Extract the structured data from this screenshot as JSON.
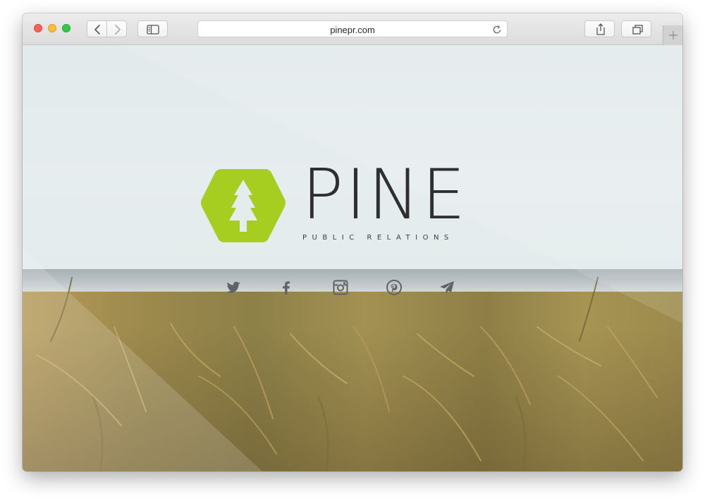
{
  "browser": {
    "url": "pinepr.com",
    "icons": [
      "back-chevron-icon",
      "forward-chevron-icon",
      "sidebar-icon",
      "reload-icon",
      "share-icon",
      "tabs-icon",
      "plus-icon"
    ]
  },
  "site": {
    "brand_name": "PINE",
    "tagline": "PUBLIC RELATIONS",
    "logo_color": "#a6ce21",
    "social_icons": [
      "twitter-icon",
      "facebook-icon",
      "instagram-icon",
      "pinterest-icon",
      "send-icon"
    ]
  }
}
